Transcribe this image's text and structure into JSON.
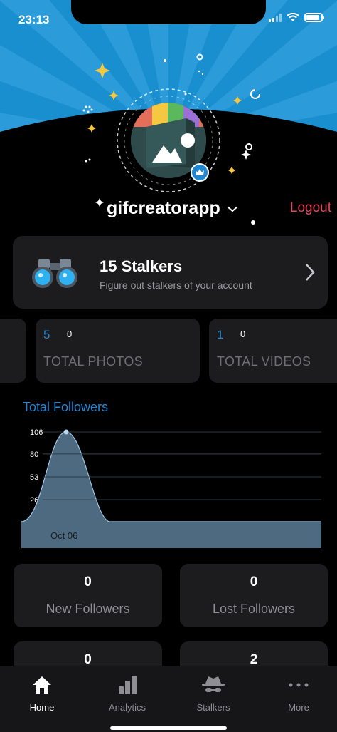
{
  "status_bar": {
    "time": "23:13"
  },
  "profile": {
    "username": "gifcreatorapp",
    "logout_label": "Logout"
  },
  "stalkers": {
    "title": "15 Stalkers",
    "subtitle": "Figure out stalkers of your account"
  },
  "stats": [
    {
      "value": "5",
      "delta": "0",
      "label": "TOTAL PHOTOS"
    },
    {
      "value": "1",
      "delta": "0",
      "label": "TOTAL VIDEOS"
    }
  ],
  "chart_title": "Total Followers",
  "chart_data": {
    "type": "area",
    "title": "Total Followers",
    "x": [
      "",
      "Oct 06",
      ""
    ],
    "xlabel": "",
    "ylabel": "",
    "yticks": [
      0,
      26,
      53,
      80,
      106
    ],
    "ylim": [
      0,
      106
    ],
    "series": [
      {
        "values": [
          0,
          106,
          0,
          0
        ]
      }
    ],
    "grid": true
  },
  "tiles": [
    {
      "value": "0",
      "label": "New Followers"
    },
    {
      "value": "0",
      "label": "Lost Followers"
    },
    {
      "value": "0",
      "label": ""
    },
    {
      "value": "2",
      "label": ""
    }
  ],
  "tabs": [
    {
      "label": "Home",
      "icon": "home-icon"
    },
    {
      "label": "Analytics",
      "icon": "bar-chart-icon"
    },
    {
      "label": "Stalkers",
      "icon": "spy-icon"
    },
    {
      "label": "More",
      "icon": "more-dots-icon"
    }
  ],
  "colors": {
    "accent": "#1f86d4",
    "logout": "#e8455b",
    "card": "#1c1c1e",
    "chart_fill": "#4d6a80"
  }
}
